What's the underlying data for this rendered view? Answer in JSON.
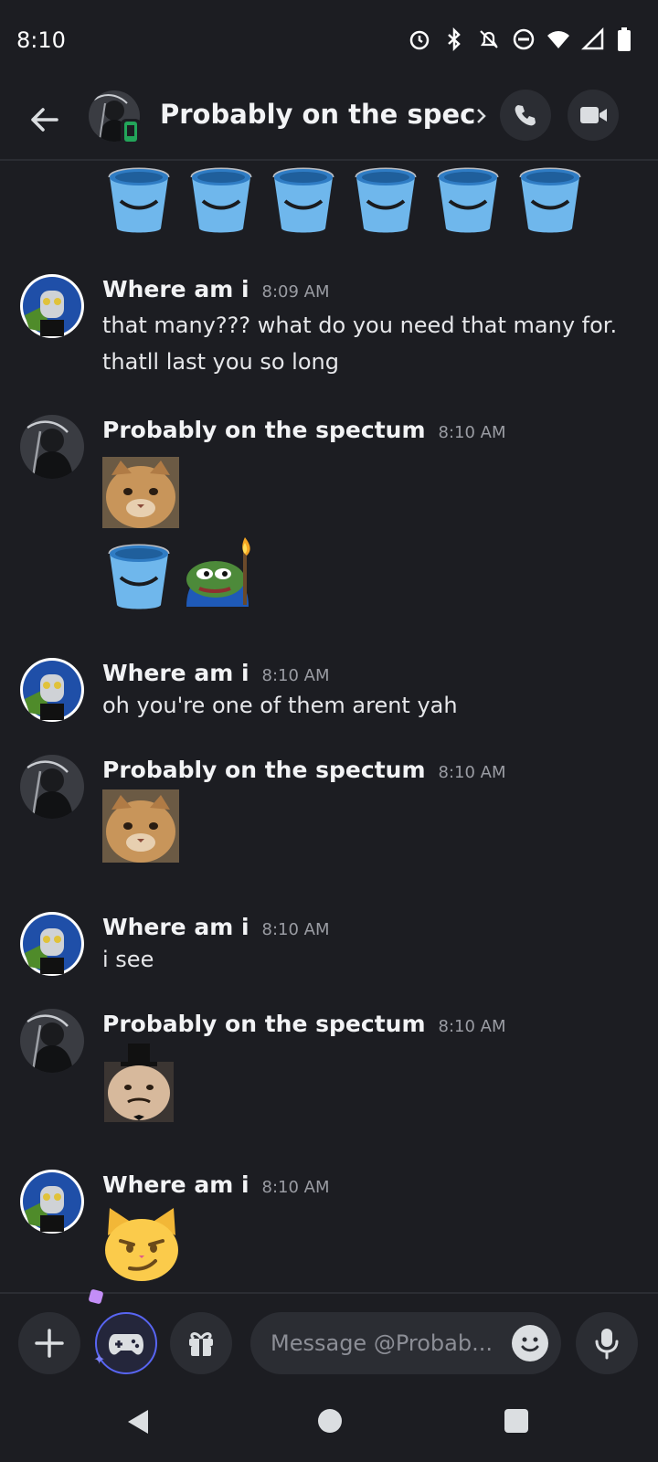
{
  "status_bar": {
    "time": "8:10"
  },
  "header": {
    "title": "Probably on the spect...",
    "chevron": "›"
  },
  "messages": [
    {
      "author": "Where am i",
      "time": "8:09 AM",
      "text": "that many??? what do you need that many for. thatll last you so long"
    },
    {
      "author": "Probably on the spectum",
      "time": "8:10 AM",
      "attachments": [
        "cat-sticker",
        "bucket-emoji",
        "pepe-torch-emoji"
      ]
    },
    {
      "author": "Where am i",
      "time": "8:10 AM",
      "text": "oh you're one of them arent yah"
    },
    {
      "author": "Probably on the spectum",
      "time": "8:10 AM",
      "attachments": [
        "cat-sticker"
      ]
    },
    {
      "author": "Where am i",
      "time": "8:10 AM",
      "text": "i see"
    },
    {
      "author": "Probably on the spectum",
      "time": "8:10 AM",
      "attachments": [
        "top-hat-cat-sticker"
      ]
    },
    {
      "author": "Where am i",
      "time": "8:10 AM",
      "attachments": [
        "smirk-cat-emoji"
      ]
    }
  ],
  "composer": {
    "placeholder": "Message @Probab..."
  },
  "icons": [
    "back-arrow-icon",
    "phone-icon",
    "video-icon",
    "plus-icon",
    "gamepad-icon",
    "gift-icon",
    "emoji-icon",
    "mic-icon"
  ],
  "colors": {
    "background": "#1c1d22",
    "surface": "#2b2d33",
    "accent": "#5865f2",
    "timestamp": "#9a9ca3"
  }
}
